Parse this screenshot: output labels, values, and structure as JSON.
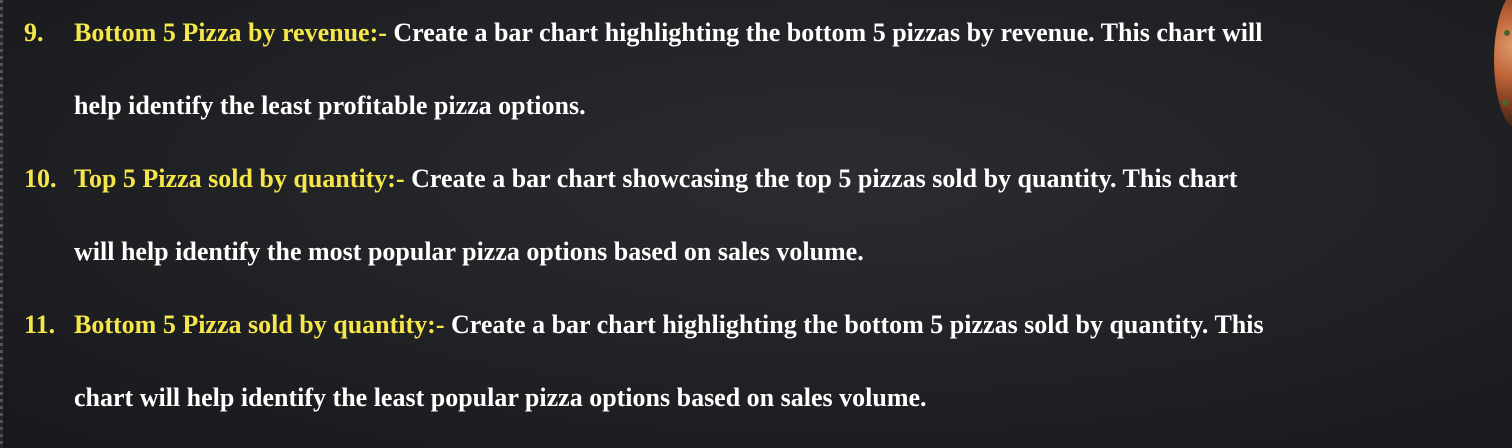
{
  "items": [
    {
      "number": "9.",
      "heading": "Bottom 5 Pizza by revenue:-",
      "line1": "Create a bar chart highlighting the bottom 5 pizzas by revenue. This chart will",
      "line2": "help identify the least profitable pizza options."
    },
    {
      "number": "10.",
      "heading": "Top 5 Pizza sold by quantity:-",
      "line1": "Create a bar chart showcasing the top 5 pizzas sold by quantity. This chart",
      "line2": "will help identify the most popular pizza options based on sales volume."
    },
    {
      "number": "11.",
      "heading": "Bottom 5 Pizza sold by quantity:-",
      "line1": "Create a bar chart highlighting the bottom 5 pizzas sold by quantity. This",
      "line2": "chart will help identify the least popular pizza options based on sales volume."
    }
  ],
  "colors": {
    "accent": "#f5e64a",
    "text": "#ffffff",
    "background": "#1f2124"
  },
  "icons": {
    "decoration": "pizza-slice-image"
  }
}
